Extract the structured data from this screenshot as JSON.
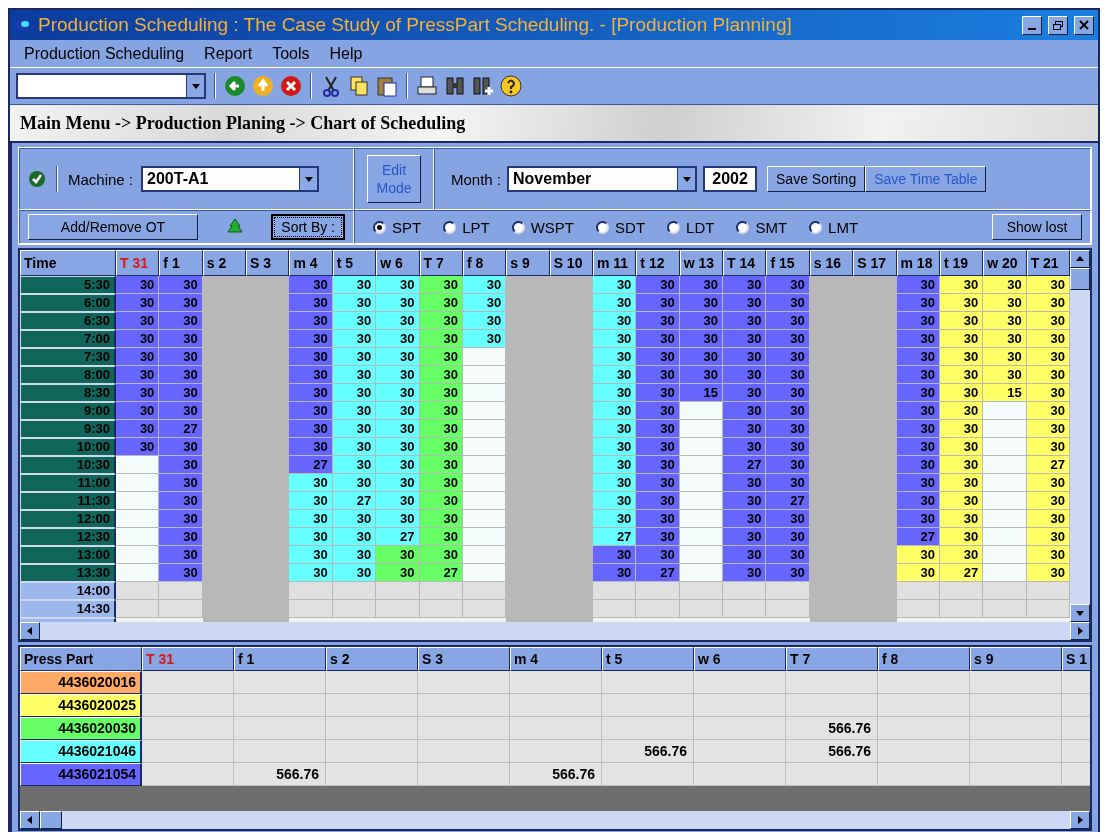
{
  "window": {
    "title": "Production Scheduling : The Case Study of PressPart Scheduling. - [Production Planning]"
  },
  "menu": [
    "Production Scheduling",
    "Report",
    "Tools",
    "Help"
  ],
  "breadcrumb": "Main Menu -> Production Planing -> Chart of Scheduling",
  "controls": {
    "machine_label": "Machine :",
    "machine": "200T-A1",
    "add_remove": "Add/Remove OT",
    "sort_by": "Sort By :",
    "edit_mode": {
      "label": "Edit Mode",
      "disabled": true
    },
    "month_label": "Month :",
    "month": "November",
    "year": "2002",
    "save_sorting": {
      "label": "Save Sorting",
      "disabled": false
    },
    "save_time_table": {
      "label": "Save Time Table",
      "disabled": true
    },
    "show_lost": "Show lost",
    "rules": [
      {
        "label": "SPT",
        "selected": true
      },
      {
        "label": "LPT",
        "selected": false
      },
      {
        "label": "WSPT",
        "selected": false
      },
      {
        "label": "SDT",
        "selected": false
      },
      {
        "label": "LDT",
        "selected": false
      },
      {
        "label": "SMT",
        "selected": false
      },
      {
        "label": "LMT",
        "selected": false
      }
    ]
  },
  "schedule": {
    "corner": "Time",
    "times": [
      {
        "time": "5:30",
        "working": true
      },
      {
        "time": "6:00",
        "working": true
      },
      {
        "time": "6:30",
        "working": true
      },
      {
        "time": "7:00",
        "working": true
      },
      {
        "time": "7:30",
        "working": true
      },
      {
        "time": "8:00",
        "working": true
      },
      {
        "time": "8:30",
        "working": true
      },
      {
        "time": "9:00",
        "working": true
      },
      {
        "time": "9:30",
        "working": true
      },
      {
        "time": "10:00",
        "working": true
      },
      {
        "time": "10:30",
        "working": true
      },
      {
        "time": "11:00",
        "working": true
      },
      {
        "time": "11:30",
        "working": true
      },
      {
        "time": "12:00",
        "working": true
      },
      {
        "time": "12:30",
        "working": true
      },
      {
        "time": "13:00",
        "working": true
      },
      {
        "time": "13:30",
        "working": true
      },
      {
        "time": "14:00",
        "working": false
      },
      {
        "time": "14:30",
        "working": false
      }
    ],
    "columns": [
      {
        "label": "T 31",
        "other_month": true,
        "off": false,
        "cells": [
          {
            "value": "30",
            "color": "#6666ff"
          },
          {
            "value": "30",
            "color": "#6666ff"
          },
          {
            "value": "30",
            "color": "#6666ff"
          },
          {
            "value": "30",
            "color": "#6666ff"
          },
          {
            "value": "30",
            "color": "#6666ff"
          },
          {
            "value": "30",
            "color": "#6666ff"
          },
          {
            "value": "30",
            "color": "#6666ff"
          },
          {
            "value": "30",
            "color": "#6666ff"
          },
          {
            "value": "30",
            "color": "#6666ff"
          },
          {
            "value": "30",
            "color": "#6666ff"
          },
          {
            "color": "#f4fbfb"
          },
          {
            "color": "#f4fbfb"
          },
          {
            "color": "#f4fbfb"
          },
          {
            "color": "#f4fbfb"
          },
          {
            "color": "#f4fbfb"
          },
          {
            "color": "#f4fbfb"
          },
          {
            "color": "#f4fbfb"
          }
        ]
      },
      {
        "label": "f 1",
        "other_month": false,
        "off": false,
        "cells": [
          {
            "value": "30",
            "color": "#6666ff"
          },
          {
            "value": "30",
            "color": "#6666ff"
          },
          {
            "value": "30",
            "color": "#6666ff"
          },
          {
            "value": "30",
            "color": "#6666ff"
          },
          {
            "value": "30",
            "color": "#6666ff"
          },
          {
            "value": "30",
            "color": "#6666ff"
          },
          {
            "value": "30",
            "color": "#6666ff"
          },
          {
            "value": "30",
            "color": "#6666ff"
          },
          {
            "value": "27",
            "color": "#6666ff"
          },
          {
            "value": "30",
            "color": "#6666ff"
          },
          {
            "value": "30",
            "color": "#6666ff"
          },
          {
            "value": "30",
            "color": "#6666ff"
          },
          {
            "value": "30",
            "color": "#6666ff"
          },
          {
            "value": "30",
            "color": "#6666ff"
          },
          {
            "value": "30",
            "color": "#6666ff"
          },
          {
            "value": "30",
            "color": "#6666ff"
          },
          {
            "value": "30",
            "color": "#6666ff"
          }
        ]
      },
      {
        "label": "s 2",
        "other_month": false,
        "off": true
      },
      {
        "label": "S 3",
        "other_month": false,
        "off": true
      },
      {
        "label": "m 4",
        "other_month": false,
        "off": false,
        "cells": [
          {
            "value": "30",
            "color": "#6666ff"
          },
          {
            "value": "30",
            "color": "#6666ff"
          },
          {
            "value": "30",
            "color": "#6666ff"
          },
          {
            "value": "30",
            "color": "#6666ff"
          },
          {
            "value": "30",
            "color": "#6666ff"
          },
          {
            "value": "30",
            "color": "#6666ff"
          },
          {
            "value": "30",
            "color": "#6666ff"
          },
          {
            "value": "30",
            "color": "#6666ff"
          },
          {
            "value": "30",
            "color": "#6666ff"
          },
          {
            "value": "30",
            "color": "#6666ff"
          },
          {
            "value": "27",
            "color": "#6666ff"
          },
          {
            "value": "30",
            "color": "#66ffff"
          },
          {
            "value": "30",
            "color": "#66ffff"
          },
          {
            "value": "30",
            "color": "#66ffff"
          },
          {
            "value": "30",
            "color": "#66ffff"
          },
          {
            "value": "30",
            "color": "#66ffff"
          },
          {
            "value": "30",
            "color": "#66ffff"
          }
        ]
      },
      {
        "label": "t 5",
        "other_month": false,
        "off": false,
        "cells": [
          {
            "value": "30",
            "color": "#66ffff"
          },
          {
            "value": "30",
            "color": "#66ffff"
          },
          {
            "value": "30",
            "color": "#66ffff"
          },
          {
            "value": "30",
            "color": "#66ffff"
          },
          {
            "value": "30",
            "color": "#66ffff"
          },
          {
            "value": "30",
            "color": "#66ffff"
          },
          {
            "value": "30",
            "color": "#66ffff"
          },
          {
            "value": "30",
            "color": "#66ffff"
          },
          {
            "value": "30",
            "color": "#66ffff"
          },
          {
            "value": "30",
            "color": "#66ffff"
          },
          {
            "value": "30",
            "color": "#66ffff"
          },
          {
            "value": "30",
            "color": "#66ffff"
          },
          {
            "value": "27",
            "color": "#66ffff"
          },
          {
            "value": "30",
            "color": "#66ffff"
          },
          {
            "value": "30",
            "color": "#66ffff"
          },
          {
            "value": "30",
            "color": "#66ffff"
          },
          {
            "value": "30",
            "color": "#66ffff"
          }
        ]
      },
      {
        "label": "w 6",
        "other_month": false,
        "off": false,
        "cells": [
          {
            "value": "30",
            "color": "#66ffff"
          },
          {
            "value": "30",
            "color": "#66ffff"
          },
          {
            "value": "30",
            "color": "#66ffff"
          },
          {
            "value": "30",
            "color": "#66ffff"
          },
          {
            "value": "30",
            "color": "#66ffff"
          },
          {
            "value": "30",
            "color": "#66ffff"
          },
          {
            "value": "30",
            "color": "#66ffff"
          },
          {
            "value": "30",
            "color": "#66ffff"
          },
          {
            "value": "30",
            "color": "#66ffff"
          },
          {
            "value": "30",
            "color": "#66ffff"
          },
          {
            "value": "30",
            "color": "#66ffff"
          },
          {
            "value": "30",
            "color": "#66ffff"
          },
          {
            "value": "30",
            "color": "#66ffff"
          },
          {
            "value": "30",
            "color": "#66ffff"
          },
          {
            "value": "27",
            "color": "#66ffff"
          },
          {
            "value": "30",
            "color": "#66ff66"
          },
          {
            "value": "30",
            "color": "#66ff66"
          }
        ]
      },
      {
        "label": "T 7",
        "other_month": false,
        "off": false,
        "cells": [
          {
            "value": "30",
            "color": "#66ff66"
          },
          {
            "value": "30",
            "color": "#66ff66"
          },
          {
            "value": "30",
            "color": "#66ff66"
          },
          {
            "value": "30",
            "color": "#66ff66"
          },
          {
            "value": "30",
            "color": "#66ff66"
          },
          {
            "value": "30",
            "color": "#66ff66"
          },
          {
            "value": "30",
            "color": "#66ff66"
          },
          {
            "value": "30",
            "color": "#66ff66"
          },
          {
            "value": "30",
            "color": "#66ff66"
          },
          {
            "value": "30",
            "color": "#66ff66"
          },
          {
            "value": "30",
            "color": "#66ff66"
          },
          {
            "value": "30",
            "color": "#66ff66"
          },
          {
            "value": "30",
            "color": "#66ff66"
          },
          {
            "value": "30",
            "color": "#66ff66"
          },
          {
            "value": "30",
            "color": "#66ff66"
          },
          {
            "value": "30",
            "color": "#66ff66"
          },
          {
            "value": "27",
            "color": "#66ff66"
          }
        ]
      },
      {
        "label": "f 8",
        "other_month": false,
        "off": false,
        "cells": [
          {
            "value": "30",
            "color": "#66ffff"
          },
          {
            "value": "30",
            "color": "#66ffff"
          },
          {
            "value": "30",
            "color": "#66ffff"
          },
          {
            "value": "30",
            "color": "#66ffff"
          },
          {
            "color": "#f4fbfb"
          },
          {
            "color": "#f4fbfb"
          },
          {
            "color": "#f4fbfb"
          },
          {
            "color": "#f4fbfb"
          },
          {
            "color": "#f4fbfb"
          },
          {
            "color": "#f4fbfb"
          },
          {
            "color": "#f4fbfb"
          },
          {
            "color": "#f4fbfb"
          },
          {
            "color": "#f4fbfb"
          },
          {
            "color": "#f4fbfb"
          },
          {
            "color": "#f4fbfb"
          },
          {
            "color": "#f4fbfb"
          },
          {
            "color": "#f4fbfb"
          }
        ]
      },
      {
        "label": "s 9",
        "other_month": false,
        "off": true
      },
      {
        "label": "S 10",
        "other_month": false,
        "off": true
      },
      {
        "label": "m 11",
        "other_month": false,
        "off": false,
        "cells": [
          {
            "value": "30",
            "color": "#66ffff"
          },
          {
            "value": "30",
            "color": "#66ffff"
          },
          {
            "value": "30",
            "color": "#66ffff"
          },
          {
            "value": "30",
            "color": "#66ffff"
          },
          {
            "value": "30",
            "color": "#66ffff"
          },
          {
            "value": "30",
            "color": "#66ffff"
          },
          {
            "value": "30",
            "color": "#66ffff"
          },
          {
            "value": "30",
            "color": "#66ffff"
          },
          {
            "value": "30",
            "color": "#66ffff"
          },
          {
            "value": "30",
            "color": "#66ffff"
          },
          {
            "value": "30",
            "color": "#66ffff"
          },
          {
            "value": "30",
            "color": "#66ffff"
          },
          {
            "value": "30",
            "color": "#66ffff"
          },
          {
            "value": "30",
            "color": "#66ffff"
          },
          {
            "value": "27",
            "color": "#66ffff"
          },
          {
            "value": "30",
            "color": "#6666ff"
          },
          {
            "value": "30",
            "color": "#6666ff"
          }
        ]
      },
      {
        "label": "t 12",
        "other_month": false,
        "off": false,
        "cells": [
          {
            "value": "30",
            "color": "#6666ff"
          },
          {
            "value": "30",
            "color": "#6666ff"
          },
          {
            "value": "30",
            "color": "#6666ff"
          },
          {
            "value": "30",
            "color": "#6666ff"
          },
          {
            "value": "30",
            "color": "#6666ff"
          },
          {
            "value": "30",
            "color": "#6666ff"
          },
          {
            "value": "30",
            "color": "#6666ff"
          },
          {
            "value": "30",
            "color": "#6666ff"
          },
          {
            "value": "30",
            "color": "#6666ff"
          },
          {
            "value": "30",
            "color": "#6666ff"
          },
          {
            "value": "30",
            "color": "#6666ff"
          },
          {
            "value": "30",
            "color": "#6666ff"
          },
          {
            "value": "30",
            "color": "#6666ff"
          },
          {
            "value": "30",
            "color": "#6666ff"
          },
          {
            "value": "30",
            "color": "#6666ff"
          },
          {
            "value": "30",
            "color": "#6666ff"
          },
          {
            "value": "27",
            "color": "#6666ff"
          }
        ]
      },
      {
        "label": "w 13",
        "other_month": false,
        "off": false,
        "cells": [
          {
            "value": "30",
            "color": "#6666ff"
          },
          {
            "value": "30",
            "color": "#6666ff"
          },
          {
            "value": "30",
            "color": "#6666ff"
          },
          {
            "value": "30",
            "color": "#6666ff"
          },
          {
            "value": "30",
            "color": "#6666ff"
          },
          {
            "value": "30",
            "color": "#6666ff"
          },
          {
            "value": "15",
            "color": "#6666ff"
          },
          {
            "color": "#f4fbfb"
          },
          {
            "color": "#f4fbfb"
          },
          {
            "color": "#f4fbfb"
          },
          {
            "color": "#f4fbfb"
          },
          {
            "color": "#f4fbfb"
          },
          {
            "color": "#f4fbfb"
          },
          {
            "color": "#f4fbfb"
          },
          {
            "color": "#f4fbfb"
          },
          {
            "color": "#f4fbfb"
          },
          {
            "color": "#f4fbfb"
          }
        ]
      },
      {
        "label": "T 14",
        "other_month": false,
        "off": false,
        "cells": [
          {
            "value": "30",
            "color": "#6666ff"
          },
          {
            "value": "30",
            "color": "#6666ff"
          },
          {
            "value": "30",
            "color": "#6666ff"
          },
          {
            "value": "30",
            "color": "#6666ff"
          },
          {
            "value": "30",
            "color": "#6666ff"
          },
          {
            "value": "30",
            "color": "#6666ff"
          },
          {
            "value": "30",
            "color": "#6666ff"
          },
          {
            "value": "30",
            "color": "#6666ff"
          },
          {
            "value": "30",
            "color": "#6666ff"
          },
          {
            "value": "30",
            "color": "#6666ff"
          },
          {
            "value": "27",
            "color": "#6666ff"
          },
          {
            "value": "30",
            "color": "#6666ff"
          },
          {
            "value": "30",
            "color": "#6666ff"
          },
          {
            "value": "30",
            "color": "#6666ff"
          },
          {
            "value": "30",
            "color": "#6666ff"
          },
          {
            "value": "30",
            "color": "#6666ff"
          },
          {
            "value": "30",
            "color": "#6666ff"
          }
        ]
      },
      {
        "label": "f 15",
        "other_month": false,
        "off": false,
        "cells": [
          {
            "value": "30",
            "color": "#6666ff"
          },
          {
            "value": "30",
            "color": "#6666ff"
          },
          {
            "value": "30",
            "color": "#6666ff"
          },
          {
            "value": "30",
            "color": "#6666ff"
          },
          {
            "value": "30",
            "color": "#6666ff"
          },
          {
            "value": "30",
            "color": "#6666ff"
          },
          {
            "value": "30",
            "color": "#6666ff"
          },
          {
            "value": "30",
            "color": "#6666ff"
          },
          {
            "value": "30",
            "color": "#6666ff"
          },
          {
            "value": "30",
            "color": "#6666ff"
          },
          {
            "value": "30",
            "color": "#6666ff"
          },
          {
            "value": "30",
            "color": "#6666ff"
          },
          {
            "value": "27",
            "color": "#6666ff"
          },
          {
            "value": "30",
            "color": "#6666ff"
          },
          {
            "value": "30",
            "color": "#6666ff"
          },
          {
            "value": "30",
            "color": "#6666ff"
          },
          {
            "value": "30",
            "color": "#6666ff"
          }
        ]
      },
      {
        "label": "s 16",
        "other_month": false,
        "off": true
      },
      {
        "label": "S 17",
        "other_month": false,
        "off": true
      },
      {
        "label": "m 18",
        "other_month": false,
        "off": false,
        "cells": [
          {
            "value": "30",
            "color": "#6666ff"
          },
          {
            "value": "30",
            "color": "#6666ff"
          },
          {
            "value": "30",
            "color": "#6666ff"
          },
          {
            "value": "30",
            "color": "#6666ff"
          },
          {
            "value": "30",
            "color": "#6666ff"
          },
          {
            "value": "30",
            "color": "#6666ff"
          },
          {
            "value": "30",
            "color": "#6666ff"
          },
          {
            "value": "30",
            "color": "#6666ff"
          },
          {
            "value": "30",
            "color": "#6666ff"
          },
          {
            "value": "30",
            "color": "#6666ff"
          },
          {
            "value": "30",
            "color": "#6666ff"
          },
          {
            "value": "30",
            "color": "#6666ff"
          },
          {
            "value": "30",
            "color": "#6666ff"
          },
          {
            "value": "30",
            "color": "#6666ff"
          },
          {
            "value": "27",
            "color": "#6666ff"
          },
          {
            "value": "30",
            "color": "#ffff66"
          },
          {
            "value": "30",
            "color": "#ffff66"
          }
        ]
      },
      {
        "label": "t 19",
        "other_month": false,
        "off": false,
        "cells": [
          {
            "value": "30",
            "color": "#ffff66"
          },
          {
            "value": "30",
            "color": "#ffff66"
          },
          {
            "value": "30",
            "color": "#ffff66"
          },
          {
            "value": "30",
            "color": "#ffff66"
          },
          {
            "value": "30",
            "color": "#ffff66"
          },
          {
            "value": "30",
            "color": "#ffff66"
          },
          {
            "value": "30",
            "color": "#ffff66"
          },
          {
            "value": "30",
            "color": "#ffff66"
          },
          {
            "value": "30",
            "color": "#ffff66"
          },
          {
            "value": "30",
            "color": "#ffff66"
          },
          {
            "value": "30",
            "color": "#ffff66"
          },
          {
            "value": "30",
            "color": "#ffff66"
          },
          {
            "value": "30",
            "color": "#ffff66"
          },
          {
            "value": "30",
            "color": "#ffff66"
          },
          {
            "value": "30",
            "color": "#ffff66"
          },
          {
            "value": "30",
            "color": "#ffff66"
          },
          {
            "value": "27",
            "color": "#ffff66"
          }
        ]
      },
      {
        "label": "w 20",
        "other_month": false,
        "off": false,
        "cells": [
          {
            "value": "30",
            "color": "#ffff66"
          },
          {
            "value": "30",
            "color": "#ffff66"
          },
          {
            "value": "30",
            "color": "#ffff66"
          },
          {
            "value": "30",
            "color": "#ffff66"
          },
          {
            "value": "30",
            "color": "#ffff66"
          },
          {
            "value": "30",
            "color": "#ffff66"
          },
          {
            "value": "15",
            "color": "#ffff66"
          },
          {
            "color": "#f4fbfb"
          },
          {
            "color": "#f4fbfb"
          },
          {
            "color": "#f4fbfb"
          },
          {
            "color": "#f4fbfb"
          },
          {
            "color": "#f4fbfb"
          },
          {
            "color": "#f4fbfb"
          },
          {
            "color": "#f4fbfb"
          },
          {
            "color": "#f4fbfb"
          },
          {
            "color": "#f4fbfb"
          },
          {
            "color": "#f4fbfb"
          }
        ]
      },
      {
        "label": "T 21",
        "other_month": false,
        "off": false,
        "cells": [
          {
            "value": "30",
            "color": "#ffff66"
          },
          {
            "value": "30",
            "color": "#ffff66"
          },
          {
            "value": "30",
            "color": "#ffff66"
          },
          {
            "value": "30",
            "color": "#ffff66"
          },
          {
            "value": "30",
            "color": "#ffff66"
          },
          {
            "value": "30",
            "color": "#ffff66"
          },
          {
            "value": "30",
            "color": "#ffff66"
          },
          {
            "value": "30",
            "color": "#ffff66"
          },
          {
            "value": "30",
            "color": "#ffff66"
          },
          {
            "value": "30",
            "color": "#ffff66"
          },
          {
            "value": "27",
            "color": "#ffff66"
          },
          {
            "value": "30",
            "color": "#ffff66"
          },
          {
            "value": "30",
            "color": "#ffff66"
          },
          {
            "value": "30",
            "color": "#ffff66"
          },
          {
            "value": "30",
            "color": "#ffff66"
          },
          {
            "value": "30",
            "color": "#ffff66"
          },
          {
            "value": "30",
            "color": "#ffff66"
          }
        ]
      }
    ]
  },
  "parts": {
    "corner": "Press Part",
    "columns": [
      {
        "label": "T 31",
        "other_month": true
      },
      {
        "label": "f 1",
        "other_month": false
      },
      {
        "label": "s 2",
        "other_month": false
      },
      {
        "label": "S 3",
        "other_month": false
      },
      {
        "label": "m 4",
        "other_month": false
      },
      {
        "label": "t 5",
        "other_month": false
      },
      {
        "label": "w 6",
        "other_month": false
      },
      {
        "label": "T 7",
        "other_month": false
      },
      {
        "label": "f 8",
        "other_month": false
      },
      {
        "label": "s 9",
        "other_month": false
      },
      {
        "label": "S 1",
        "other_month": false
      }
    ],
    "rows": [
      {
        "part": "4436020016",
        "color": "#ffaa66",
        "cells": [
          {},
          {},
          {},
          {},
          {},
          {},
          {},
          {},
          {},
          {},
          {}
        ]
      },
      {
        "part": "4436020025",
        "color": "#ffff66",
        "cells": [
          {},
          {},
          {},
          {},
          {},
          {},
          {},
          {},
          {},
          {},
          {}
        ]
      },
      {
        "part": "4436020030",
        "color": "#66ff66",
        "cells": [
          {},
          {},
          {},
          {},
          {},
          {},
          {},
          {
            "value": "566.76"
          },
          {},
          {},
          {}
        ]
      },
      {
        "part": "4436021046",
        "color": "#66ffff",
        "cells": [
          {},
          {},
          {},
          {},
          {},
          {
            "value": "566.76"
          },
          {},
          {
            "value": "566.76"
          },
          {},
          {},
          {}
        ]
      },
      {
        "part": "4436021054",
        "color": "#6666ff",
        "cells": [
          {},
          {
            "value": "566.76"
          },
          {},
          {},
          {
            "value": "566.76"
          },
          {},
          {},
          {},
          {},
          {},
          {}
        ]
      }
    ]
  }
}
